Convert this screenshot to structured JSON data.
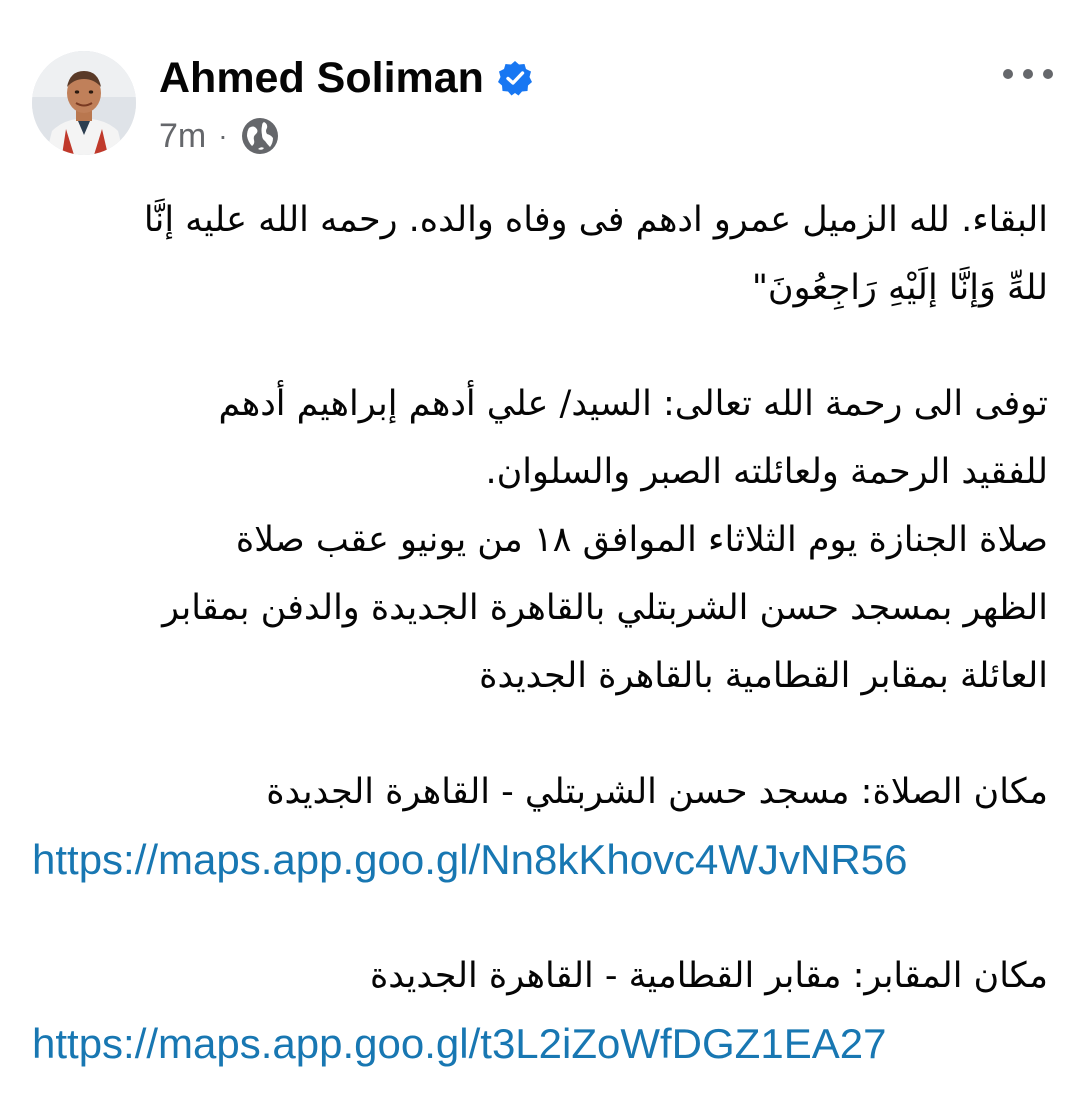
{
  "post": {
    "author": "Ahmed Soliman",
    "verified": true,
    "time": "7m",
    "separator": "·",
    "audience_icon": "globe-icon",
    "more_icon": "more-options-icon",
    "body_lines": [
      "البقاء. لله الزميل عمرو ادهم فى وفاه والده.  رحمه الله عليه إنَّا",
      "للهِّ وَإنَّا إلَيْهِ رَاجِعُونَ\"",
      "",
      "توفى الى رحمة الله تعالى: السيد/ علي أدهم إبراهيم أدهم",
      "للفقيد الرحمة ولعائلته الصبر والسلوان.",
      "صلاة الجنازة يوم الثلاثاء الموافق ١٨ من يونيو عقب صلاة",
      "الظهر بمسجد حسن الشربتلي بالقاهرة الجديدة والدفن بمقابر",
      "العائلة بمقابر القطامية بالقاهرة الجديدة"
    ],
    "prayer_location": "مكان الصلاة: مسجد حسن الشربتلي - القاهرة الجديدة",
    "prayer_link": "https://maps.app.goo.gl/Nn8kKhovc4WJvNR56",
    "burial_location": "مكان المقابر: مقابر القطامية - القاهرة الجديدة",
    "burial_link": "https://maps.app.goo.gl/t3L2iZoWfDGZ1EA27"
  },
  "colors": {
    "text": "#050505",
    "secondary": "#65676b",
    "link": "#1877b2",
    "verified": "#1877f2"
  }
}
